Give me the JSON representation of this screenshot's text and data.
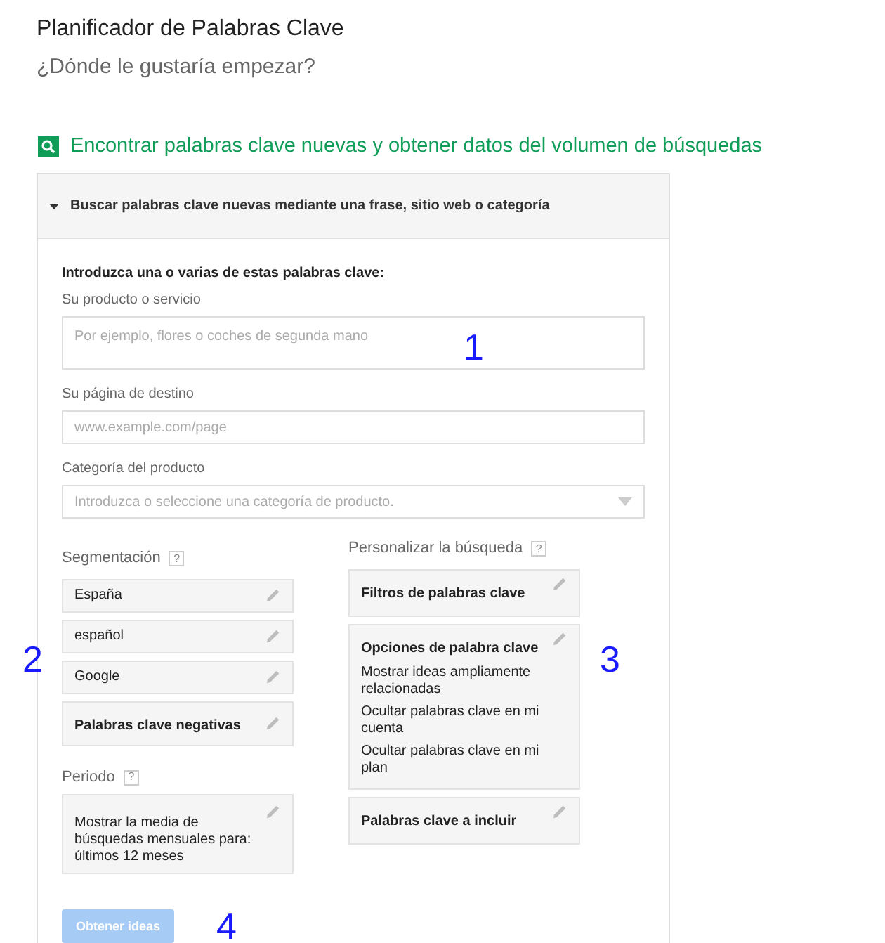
{
  "page": {
    "title": "Planificador de Palabras Clave",
    "subtitle": "¿Dónde le gustaría empezar?"
  },
  "section": {
    "heading": "Encontrar palabras clave nuevas y obtener datos del volumen de búsquedas",
    "panel_header": "Buscar palabras clave nuevas mediante una frase, sitio web o categoría",
    "expanded": true
  },
  "form": {
    "intro": "Introduzca una o varias de estas palabras clave:",
    "fields": [
      {
        "kind": "textarea",
        "label": "Su producto o servicio",
        "placeholder": "Por ejemplo, flores o coches de segunda mano"
      },
      {
        "kind": "input",
        "label": "Su página de destino",
        "placeholder": "www.example.com/page"
      },
      {
        "kind": "select",
        "label": "Categoría del producto",
        "placeholder": "Introduzca o seleccione una categoría de producto."
      }
    ]
  },
  "targeting": {
    "label": "Segmentación",
    "help": "?",
    "items": [
      {
        "title": "España",
        "bold": false
      },
      {
        "title": "español",
        "bold": false
      },
      {
        "title": "Google",
        "bold": false
      },
      {
        "title": "Palabras clave negativas",
        "bold": true
      }
    ]
  },
  "period": {
    "label": "Periodo",
    "help": "?",
    "text": "Mostrar la media de búsquedas mensuales para: últimos 12 meses"
  },
  "customize": {
    "label": "Personalizar la búsqueda",
    "help": "?",
    "items": [
      {
        "title": "Filtros de palabras clave"
      },
      {
        "title": "Opciones de palabra clave",
        "lines": [
          "Mostrar ideas ampliamente relacionadas",
          "Ocultar palabras clave en mi cuenta",
          "Ocultar palabras clave en mi plan"
        ]
      },
      {
        "title": "Palabras clave a incluir"
      }
    ]
  },
  "submit": {
    "label": "Obtener ideas",
    "disabled": true
  },
  "annotations": [
    "1",
    "2",
    "3",
    "4"
  ]
}
